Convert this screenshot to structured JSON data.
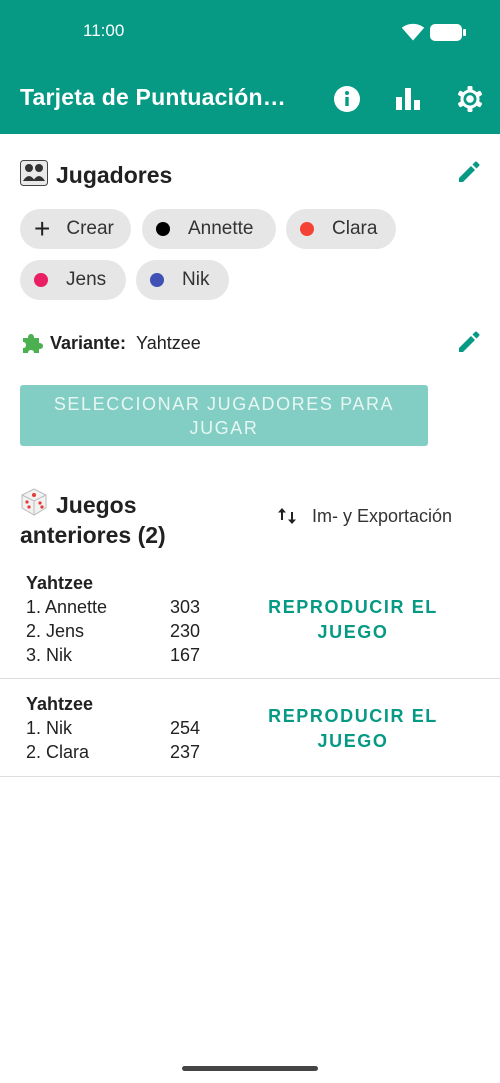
{
  "status_bar": {
    "time": "11:00"
  },
  "app_bar": {
    "title": "Tarjeta de Puntuación…",
    "actions": [
      {
        "icon": "info-icon"
      },
      {
        "icon": "bar-chart-icon"
      },
      {
        "icon": "settings-icon"
      }
    ]
  },
  "players": {
    "title": "Jugadores",
    "title_icon": "people-emoji-icon",
    "create_label": "Crear",
    "chips": [
      {
        "name": "Annette",
        "color": "#000000"
      },
      {
        "name": "Clara",
        "color": "#f44336"
      },
      {
        "name": "Jens",
        "color": "#e91e63"
      },
      {
        "name": "Nik",
        "color": "#3f51b5"
      }
    ]
  },
  "variant": {
    "label": "Variante:",
    "value": "Yahtzee",
    "icon": "puzzle-emoji-icon"
  },
  "select_button": {
    "label": "SELECCIONAR JUGADORES PARA JUGAR",
    "enabled": false
  },
  "previous_games": {
    "title": "Juegos anteriores (2)",
    "title_icon": "dice-emoji-icon",
    "export_label": "Im- y Exportación",
    "games": [
      {
        "name": "Yahtzee",
        "scores": [
          {
            "rank": "1. Annette",
            "points": "303"
          },
          {
            "rank": "2. Jens",
            "points": "230"
          },
          {
            "rank": "3. Nik",
            "points": "167"
          }
        ],
        "replay_label": "REPRODUCIR EL JUEGO"
      },
      {
        "name": "Yahtzee",
        "scores": [
          {
            "rank": "1. Nik",
            "points": "254"
          },
          {
            "rank": "2. Clara",
            "points": "237"
          }
        ],
        "replay_label": "REPRODUCIR EL JUEGO"
      }
    ]
  },
  "colors": {
    "primary": "#069a84",
    "button_disabled": "#83cec4",
    "chip_background": "#e6e6e6"
  }
}
